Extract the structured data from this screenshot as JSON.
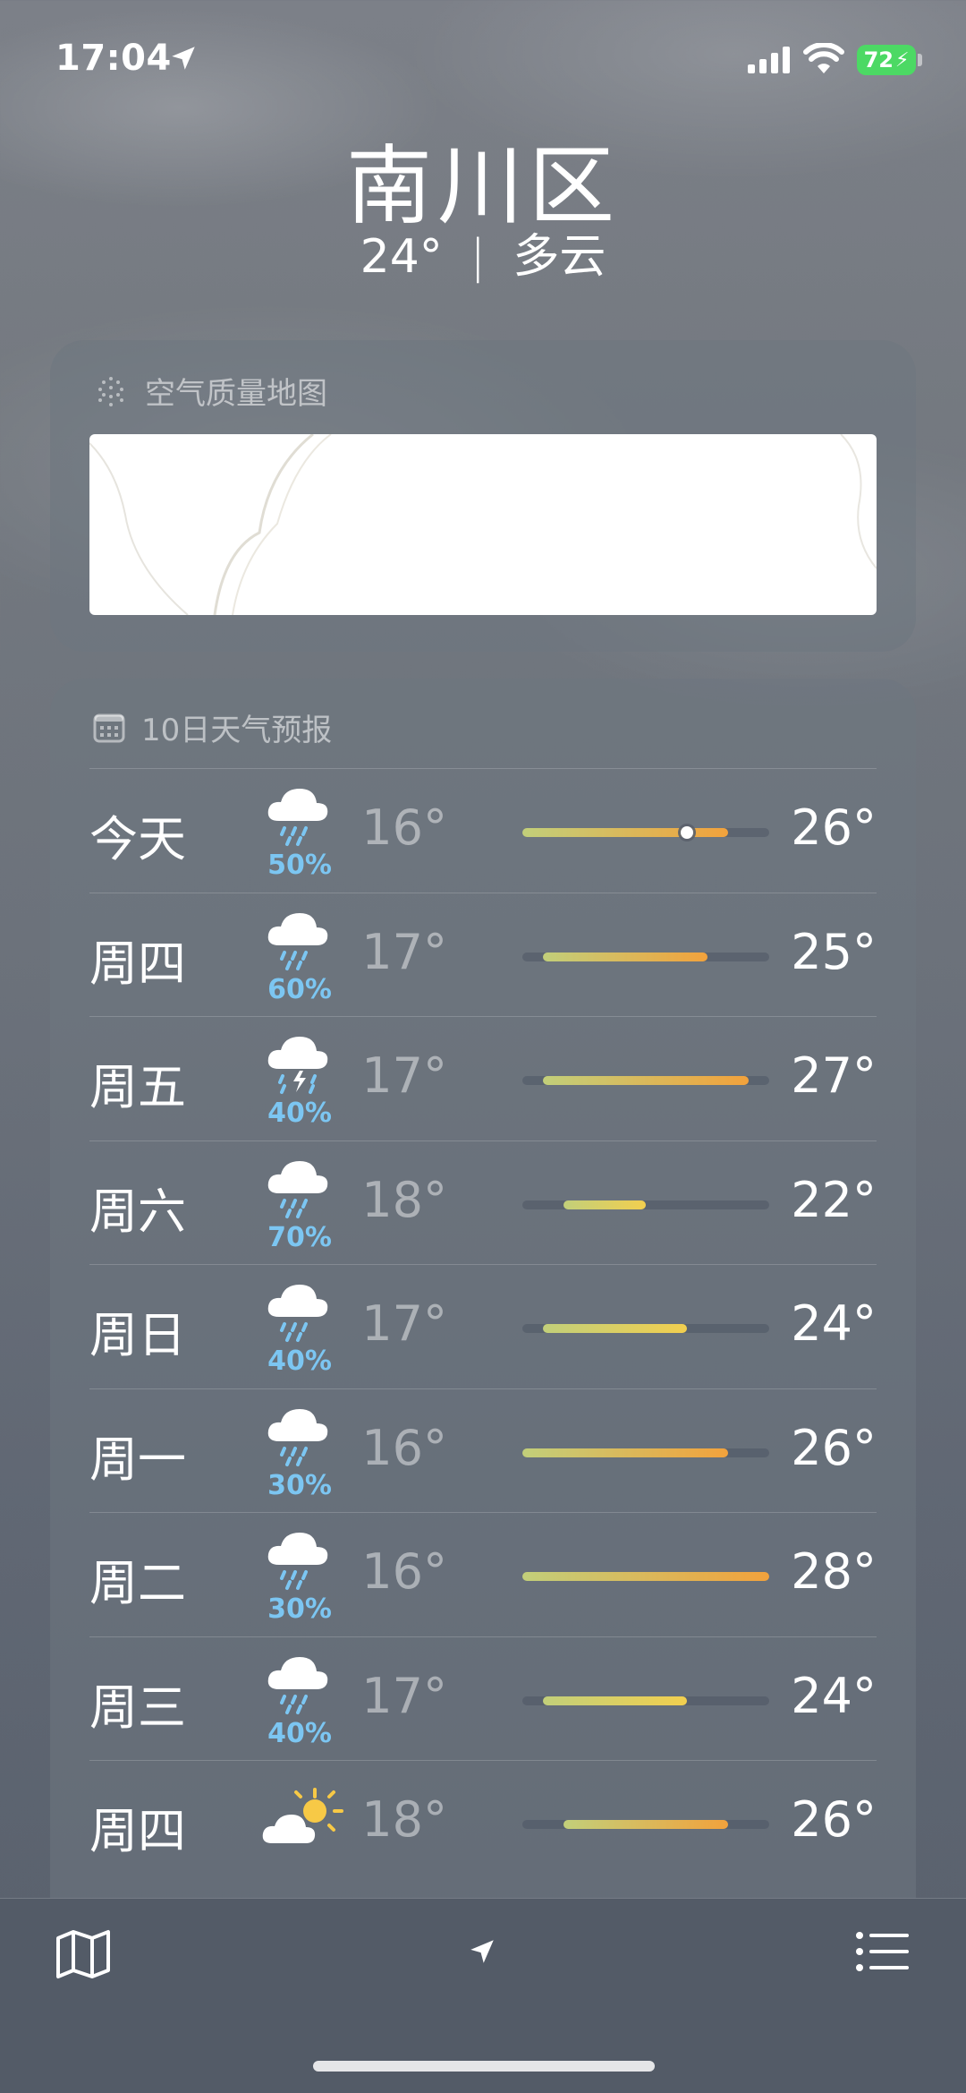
{
  "status": {
    "time": "17:04",
    "battery": "72"
  },
  "header": {
    "city": "南川区",
    "temp": "24°",
    "divider": "|",
    "condition": "多云"
  },
  "air_card": {
    "title": "空气质量地图",
    "icon": "air-quality-dots-icon"
  },
  "forecast": {
    "title": "10日天气预报",
    "icon": "calendar-icon",
    "scale": {
      "min": 16,
      "max": 28
    },
    "colors": {
      "precip": "#7cc6f2"
    },
    "days": [
      {
        "day": "今天",
        "icon": "rain-cloud-icon",
        "pct": "50%",
        "lo": "16°",
        "hi": "26°",
        "lo_v": 16,
        "hi_v": 26,
        "current": 24
      },
      {
        "day": "周四",
        "icon": "rain-cloud-icon",
        "pct": "60%",
        "lo": "17°",
        "hi": "25°",
        "lo_v": 17,
        "hi_v": 25
      },
      {
        "day": "周五",
        "icon": "thunderstorm-icon",
        "pct": "40%",
        "lo": "17°",
        "hi": "27°",
        "lo_v": 17,
        "hi_v": 27
      },
      {
        "day": "周六",
        "icon": "rain-cloud-icon",
        "pct": "70%",
        "lo": "18°",
        "hi": "22°",
        "lo_v": 18,
        "hi_v": 22
      },
      {
        "day": "周日",
        "icon": "rain-cloud-icon",
        "pct": "40%",
        "lo": "17°",
        "hi": "24°",
        "lo_v": 17,
        "hi_v": 24
      },
      {
        "day": "周一",
        "icon": "rain-cloud-icon",
        "pct": "30%",
        "lo": "16°",
        "hi": "26°",
        "lo_v": 16,
        "hi_v": 26
      },
      {
        "day": "周二",
        "icon": "rain-cloud-icon",
        "pct": "30%",
        "lo": "16°",
        "hi": "28°",
        "lo_v": 16,
        "hi_v": 28
      },
      {
        "day": "周三",
        "icon": "rain-cloud-icon",
        "pct": "40%",
        "lo": "17°",
        "hi": "24°",
        "lo_v": 17,
        "hi_v": 24
      },
      {
        "day": "周四",
        "icon": "partly-sunny-icon",
        "pct": "",
        "lo": "18°",
        "hi": "26°",
        "lo_v": 18,
        "hi_v": 26
      }
    ]
  },
  "toolbar": {
    "left_icon": "map-icon",
    "center_icon": "location-arrow-icon",
    "right_icon": "list-icon"
  }
}
